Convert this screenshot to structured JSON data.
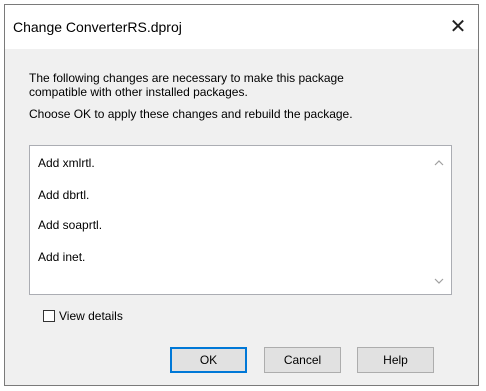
{
  "dialog": {
    "title": "Change ConverterRS.dproj",
    "close_glyph": "✕",
    "close_icon": "close-icon"
  },
  "message": {
    "line1": "The following changes are necessary to make this package",
    "line2": "compatible with other installed packages.",
    "line3": "Choose OK to apply these changes and rebuild the package."
  },
  "changes": {
    "items": [
      "Add xmlrtl.",
      "Add dbrtl.",
      "Add soaprtl.",
      "Add inet."
    ],
    "scroll_up_icon": "chevron-up-icon",
    "scroll_down_icon": "chevron-down-icon"
  },
  "view_details": {
    "label": "View details",
    "checked": false
  },
  "buttons": {
    "ok": "OK",
    "cancel": "Cancel",
    "help": "Help"
  },
  "colors": {
    "focus_border": "#0078d7",
    "dialog_bg": "#f0f0f0",
    "button_bg": "#e1e1e1"
  }
}
